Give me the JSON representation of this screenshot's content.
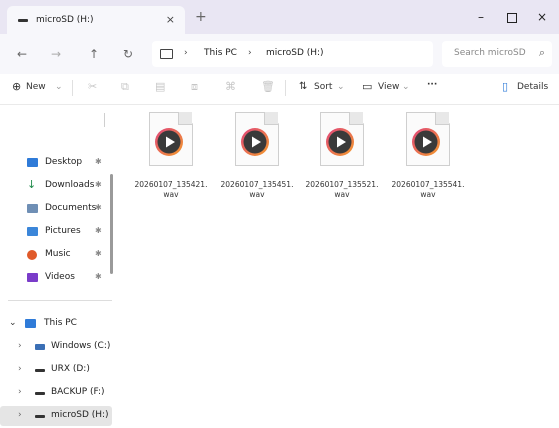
{
  "window": {
    "tab_title": "microSD (H:)",
    "tab_close": "×",
    "new_tab": "+",
    "minimize": "–",
    "close": "×"
  },
  "nav": {
    "back": "←",
    "forward": "→",
    "up": "↑",
    "refresh": "↻"
  },
  "address": {
    "separator": "›",
    "crumbs": [
      "This PC",
      "microSD (H:)"
    ]
  },
  "search": {
    "placeholder": "Search microSD",
    "icon": "⌕"
  },
  "toolbar": {
    "new_label": "New",
    "new_icon": "⊕",
    "cut_icon": "✂",
    "copy_icon": "⧉",
    "paste_icon": "▤",
    "rename_icon": "⧈",
    "share_icon": "⌘",
    "delete_icon": "🗑",
    "sort_label": "Sort",
    "sort_icon": "⇅",
    "view_label": "View",
    "view_icon": "▭",
    "more_label": "···",
    "details_label": "Details",
    "details_icon": "▯",
    "dropdown": "⌄"
  },
  "sidebar": {
    "quick_access": [
      {
        "label": "Desktop",
        "color": "#2f7bd8"
      },
      {
        "label": "Downloads",
        "color": "#1f8a4a"
      },
      {
        "label": "Documents",
        "color": "#6f8fb5"
      },
      {
        "label": "Pictures",
        "color": "#3b86d9"
      },
      {
        "label": "Music",
        "color": "#e05a2a"
      },
      {
        "label": "Videos",
        "color": "#7a3cc9"
      }
    ],
    "pin": "✱",
    "this_pc": "This PC",
    "drives": [
      "Windows (C:)",
      "URX (D:)",
      "BACKUP (F:)",
      "microSD (H:)"
    ],
    "expand": "›",
    "collapse": "⌄"
  },
  "files": [
    {
      "name": "20260107_135421.",
      "ext": "wav"
    },
    {
      "name": "20260107_135451.",
      "ext": "wav"
    },
    {
      "name": "20260107_135521.",
      "ext": "wav"
    },
    {
      "name": "20260107_135541.",
      "ext": "wav"
    }
  ],
  "colors": {
    "accent": "#2f7bd8",
    "titlebar": "#e9e6f3",
    "play_ring_start": "#e0457b",
    "play_ring_end": "#f39a2b"
  }
}
